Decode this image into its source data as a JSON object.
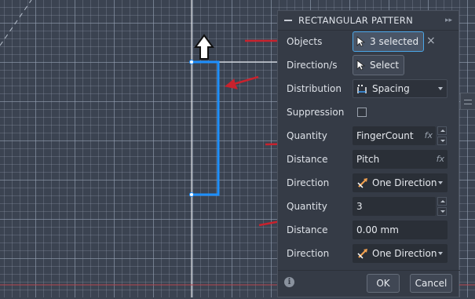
{
  "dialog": {
    "title": "RECTANGULAR PATTERN",
    "expand_icon": "double-chevron-right",
    "objects": {
      "label": "Objects",
      "value": "3 selected",
      "clear": "×"
    },
    "directions": {
      "label": "Direction/s",
      "value": "Select"
    },
    "distribution": {
      "label": "Distribution",
      "value": "Spacing"
    },
    "suppression": {
      "label": "Suppression",
      "checked": false
    },
    "quantity1": {
      "label": "Quantity",
      "value": "FingerCount",
      "fx": "fx"
    },
    "distance1": {
      "label": "Distance",
      "value": "Pitch",
      "fx": "fx"
    },
    "direction1": {
      "label": "Direction",
      "value": "One Direction"
    },
    "quantity2": {
      "label": "Quantity",
      "value": "3"
    },
    "distance2": {
      "label": "Distance",
      "value": "0.00 mm"
    },
    "direction2": {
      "label": "Direction",
      "value": "One Direction"
    },
    "info": "i",
    "ok_label": "OK",
    "cancel_label": "Cancel"
  },
  "colors": {
    "canvas": "#3b4351",
    "sketch_selected": "#1e90ff",
    "annotation_arrow": "#c8222d",
    "axis_red": "#b8454d"
  }
}
